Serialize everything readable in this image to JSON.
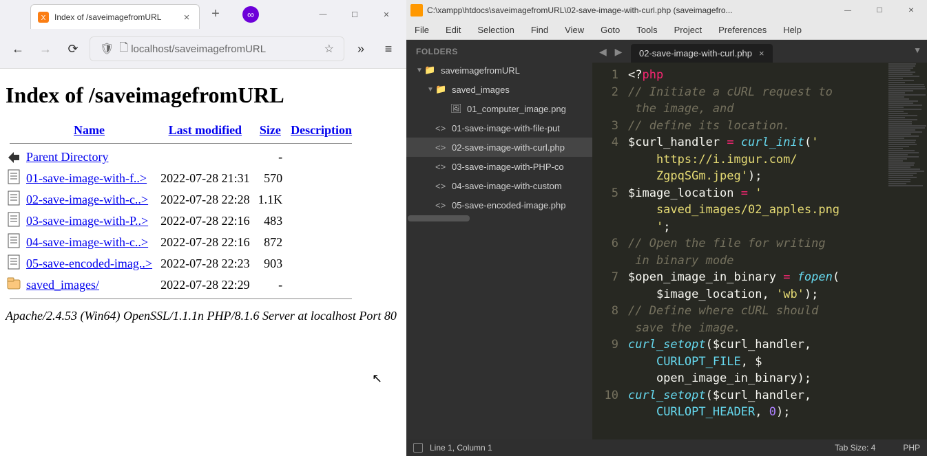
{
  "browser": {
    "tab_title": "Index of /saveimagefromURL",
    "url": "localhost/saveimagefromURL",
    "page_heading": "Index of /saveimagefromURL",
    "columns": {
      "name": "Name",
      "modified": "Last modified",
      "size": "Size",
      "desc": "Description"
    },
    "parent_dir_label": "Parent Directory",
    "rows": [
      {
        "name": "01-save-image-with-f..>",
        "modified": "2022-07-28 21:31",
        "size": "570",
        "type": "file"
      },
      {
        "name": "02-save-image-with-c..>",
        "modified": "2022-07-28 22:28",
        "size": "1.1K",
        "type": "file"
      },
      {
        "name": "03-save-image-with-P..>",
        "modified": "2022-07-28 22:16",
        "size": "483",
        "type": "file"
      },
      {
        "name": "04-save-image-with-c..>",
        "modified": "2022-07-28 22:16",
        "size": "872",
        "type": "file"
      },
      {
        "name": "05-save-encoded-imag..>",
        "modified": "2022-07-28 22:23",
        "size": "903",
        "type": "file"
      },
      {
        "name": "saved_images/",
        "modified": "2022-07-28 22:29",
        "size": "-",
        "type": "folder"
      }
    ],
    "server_signature": "Apache/2.4.53 (Win64) OpenSSL/1.1.1n PHP/8.1.6 Server at localhost Port 80"
  },
  "sublime": {
    "title": "C:\\xampp\\htdocs\\saveimagefromURL\\02-save-image-with-curl.php (saveimagefro...",
    "menu": [
      "File",
      "Edit",
      "Selection",
      "Find",
      "View",
      "Goto",
      "Tools",
      "Project",
      "Preferences",
      "Help"
    ],
    "sidebar_header": "FOLDERS",
    "tree": [
      {
        "name": "saveimagefromURL",
        "depth": 0,
        "type": "folder-open"
      },
      {
        "name": "saved_images",
        "depth": 1,
        "type": "folder-open"
      },
      {
        "name": "01_computer_image.png",
        "depth": 2,
        "type": "image"
      },
      {
        "name": "01-save-image-with-file-put",
        "depth": 1,
        "type": "php"
      },
      {
        "name": "02-save-image-with-curl.php",
        "depth": 1,
        "type": "php",
        "active": true
      },
      {
        "name": "03-save-image-with-PHP-co",
        "depth": 1,
        "type": "php"
      },
      {
        "name": "04-save-image-with-custom",
        "depth": 1,
        "type": "php"
      },
      {
        "name": "05-save-encoded-image.php",
        "depth": 1,
        "type": "php"
      }
    ],
    "open_tab": "02-save-image-with-curl.php",
    "gutter": [
      "1",
      "2",
      "",
      "3",
      "4",
      "",
      "",
      "5",
      "",
      "",
      "6",
      "",
      "7",
      "",
      "8",
      "",
      "9",
      "",
      "",
      "10",
      ""
    ],
    "code_lines": [
      [
        [
          "c-phpq",
          "<?"
        ],
        [
          "c-php",
          "php"
        ]
      ],
      [
        [
          "c-comment",
          "// Initiate a cURL request to"
        ]
      ],
      [
        [
          "c-comment",
          " the image, and"
        ]
      ],
      [
        [
          "c-comment",
          "// define its location."
        ]
      ],
      [
        [
          "c-var",
          "$curl_handler"
        ],
        [
          "c-punct",
          " "
        ],
        [
          "c-op",
          "="
        ],
        [
          "c-punct",
          " "
        ],
        [
          "c-func",
          "curl_init"
        ],
        [
          "c-punct",
          "("
        ],
        [
          "c-str",
          "'"
        ]
      ],
      [
        [
          "c-str",
          "    https://i.imgur.com/"
        ]
      ],
      [
        [
          "c-str",
          "    ZgpqSGm.jpeg'"
        ],
        [
          "c-punct",
          ");"
        ]
      ],
      [
        [
          "c-var",
          "$image_location"
        ],
        [
          "c-punct",
          " "
        ],
        [
          "c-op",
          "="
        ],
        [
          "c-punct",
          " "
        ],
        [
          "c-str",
          "'"
        ]
      ],
      [
        [
          "c-str",
          "    saved_images/02_apples.png"
        ]
      ],
      [
        [
          "c-str",
          "    '"
        ],
        [
          "c-punct",
          ";"
        ]
      ],
      [
        [
          "c-comment",
          "// Open the file for writing"
        ]
      ],
      [
        [
          "c-comment",
          " in binary mode"
        ]
      ],
      [
        [
          "c-var",
          "$open_image_in_binary"
        ],
        [
          "c-punct",
          " "
        ],
        [
          "c-op",
          "="
        ],
        [
          "c-punct",
          " "
        ],
        [
          "c-func",
          "fopen"
        ],
        [
          "c-punct",
          "("
        ]
      ],
      [
        [
          "c-punct",
          "    "
        ],
        [
          "c-var",
          "$image_location"
        ],
        [
          "c-punct",
          ", "
        ],
        [
          "c-str",
          "'wb'"
        ],
        [
          "c-punct",
          ");"
        ]
      ],
      [
        [
          "c-comment",
          "// Define where cURL should"
        ]
      ],
      [
        [
          "c-comment",
          " save the image."
        ]
      ],
      [
        [
          "c-func",
          "curl_setopt"
        ],
        [
          "c-punct",
          "("
        ],
        [
          "c-var",
          "$curl_handler"
        ],
        [
          "c-punct",
          ","
        ]
      ],
      [
        [
          "c-punct",
          "    "
        ],
        [
          "c-const",
          "CURLOPT_FILE"
        ],
        [
          "c-punct",
          ", "
        ],
        [
          "c-var",
          "$"
        ]
      ],
      [
        [
          "c-var",
          "    open_image_in_binary"
        ],
        [
          "c-punct",
          ");"
        ]
      ],
      [
        [
          "c-func",
          "curl_setopt"
        ],
        [
          "c-punct",
          "("
        ],
        [
          "c-var",
          "$curl_handler"
        ],
        [
          "c-punct",
          ","
        ]
      ],
      [
        [
          "c-punct",
          "    "
        ],
        [
          "c-const",
          "CURLOPT_HEADER"
        ],
        [
          "c-punct",
          ", "
        ],
        [
          "c-num",
          "0"
        ],
        [
          "c-punct",
          ");"
        ]
      ]
    ],
    "status_left": "Line 1, Column 1",
    "status_tab": "Tab Size: 4",
    "status_lang": "PHP"
  }
}
